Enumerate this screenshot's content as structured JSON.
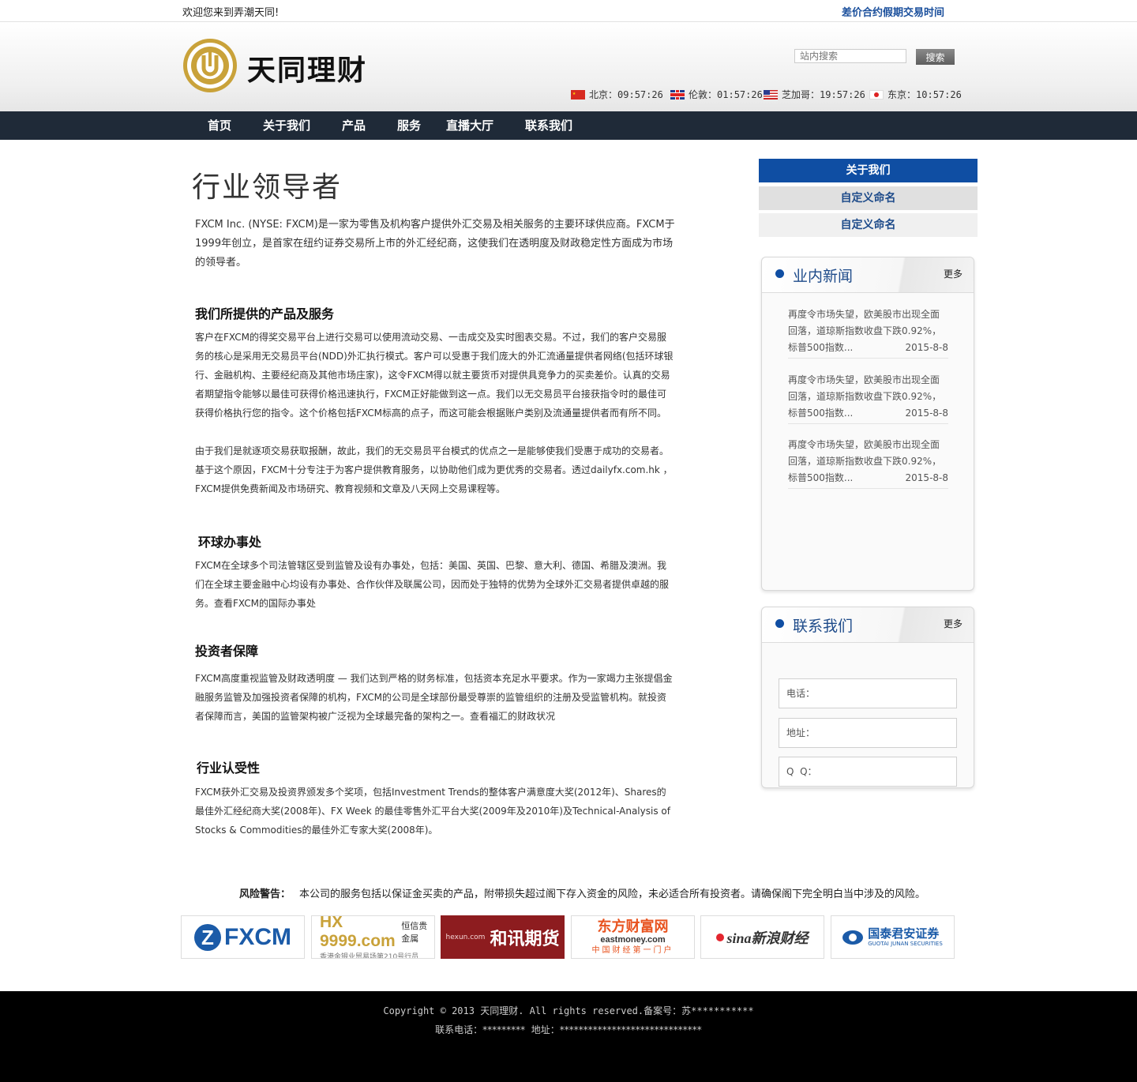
{
  "topbar": {
    "welcome": "欢迎您来到弄潮天同!",
    "holiday_link": "差价合约假期交易时间"
  },
  "header": {
    "logo_text": "天同理财",
    "search_placeholder": "站内搜索",
    "search_button": "搜索",
    "clocks": [
      {
        "city": "北京",
        "time": "09:57:26",
        "flag": "cn-flag-icon"
      },
      {
        "city": "伦敦",
        "time": "01:57:26",
        "flag": "uk-flag-icon"
      },
      {
        "city": "芝加哥",
        "time": "19:57:26",
        "flag": "us-flag-icon"
      },
      {
        "city": "东京",
        "time": "10:57:26",
        "flag": "jp-flag-icon"
      }
    ]
  },
  "nav": [
    "首页",
    "关于我们",
    "产品",
    "服务",
    "直播大厅",
    "联系我们"
  ],
  "main": {
    "title": "行业领导者",
    "intro": "FXCM Inc. (NYSE: FXCM)是一家为零售及机构客户提供外汇交易及相关服务的主要环球供应商。FXCM于1999年创立，是首家在纽约证券交易所上市的外汇经纪商，这使我们在透明度及财政稳定性方面成为市场的领导者。",
    "sections": [
      {
        "heading": "我们所提供的产品及服务",
        "body": "客户在FXCM的得奖交易平台上进行交易可以使用流动交易、一击成交及实时图表交易。不过，我们的客户交易服务的核心是采用无交易员平台(NDD)外汇执行模式。客户可以受惠于我们庞大的外汇流通量提供者网络(包括环球银行、金融机构、主要经纪商及其他市场庄家)，这令FXCM得以就主要货币对提供具竞争力的买卖差价。认真的交易者期望指令能够以最佳可获得价格迅速执行，FXCM正好能做到这一点。我们以无交易员平台接获指令时的最佳可获得价格执行您的指令。这个价格包括FXCM标高的点子，而这可能会根据账户类别及流通量提供者而有所不同。",
        "body2": "由于我们是就逐项交易获取报酬，故此，我们的无交易员平台模式的优点之一是能够使我们受惠于成功的交易者。基于这个原因，FXCM十分专注于为客户提供教育服务，以协助他们成为更优秀的交易者。透过dailyfx.com.hk ，FXCM提供免费新闻及市场研究、教育视频和文章及八天网上交易课程等。"
      },
      {
        "heading": "环球办事处",
        "body": "FXCM在全球多个司法管辖区受到监管及设有办事处，包括：美国、英国、巴黎、意大利、德国、希腊及澳洲。我们在全球主要金融中心均设有办事处、合作伙伴及联属公司，因而处于独特的优势为全球外汇交易者提供卓越的服务。查看FXCM的国际办事处"
      },
      {
        "heading": "投资者保障",
        "body": "FXCM高度重视监管及财政透明度 — 我们达到严格的财务标准，包括资本充足水平要求。作为一家竭力主张提倡金融服务监管及加强投资者保障的机构，FXCM的公司是全球部份最受尊崇的监管组织的注册及受监管机构。就投资者保障而言，美国的监管架构被广泛视为全球最完备的架构之一。查看福汇的财政状况"
      },
      {
        "heading": "行业认受性",
        "body": "FXCM获外汇交易及投资界颁发多个奖项，包括Investment Trends的整体客户满意度大奖(2012年)、Shares的最佳外汇经纪商大奖(2008年)、FX Week 的最佳零售外汇平台大奖(2009年及2010年)及Technical-Analysis of Stocks & Commodities的最佳外汇专家大奖(2008年)。"
      }
    ]
  },
  "sidebar": {
    "tabs": [
      "关于我们",
      "自定义命名",
      "自定义命名"
    ],
    "news": {
      "title": "业内新闻",
      "more": "更多",
      "items": [
        {
          "text": "再度令市场失望，欧美股市出现全面回落，道琼斯指数收盘下跌0.92%，标普500指数...",
          "date": "2015-8-8"
        },
        {
          "text": "再度令市场失望，欧美股市出现全面回落，道琼斯指数收盘下跌0.92%，标普500指数...",
          "date": "2015-8-8"
        },
        {
          "text": "再度令市场失望，欧美股市出现全面回落，道琼斯指数收盘下跌0.92%，标普500指数...",
          "date": "2015-8-8"
        }
      ]
    },
    "contact": {
      "title": "联系我们",
      "more": "更多",
      "fields": [
        "电话：",
        "地址：",
        "Q  Q："
      ]
    }
  },
  "warning": {
    "label": "风险警告：",
    "text": "本公司的服务包括以保证金买卖的产品，附带损失超过阁下存入资金的风险，未必适合所有投资者。请确保阁下完全明白当中涉及的风险。"
  },
  "partners": [
    {
      "name": "FXCM"
    },
    {
      "name": "HX 9999.com",
      "line1": "恒信贵金属",
      "line2": "香港金银业贸易场第210号行员"
    },
    {
      "name": "和讯期货",
      "sub": "hexun.com"
    },
    {
      "name": "东方财富网",
      "sub": "eastmoney.com",
      "line2": "中国财经第一门户"
    },
    {
      "name": "sina新浪财经"
    },
    {
      "name": "国泰君安证券",
      "sub": "GUOTAI JUNAN SECURITIES"
    }
  ],
  "footer": {
    "copyright": "Copyright © 2013 天同理财. All rights reserved.备案号：苏***********",
    "contact": "联系电话：*********  地址：******************************"
  },
  "colors": {
    "nav_bg": "#1f2a38",
    "accent_blue": "#0f4ea3",
    "logo_gold": "#c9a23a",
    "footer_bg": "#000000"
  }
}
